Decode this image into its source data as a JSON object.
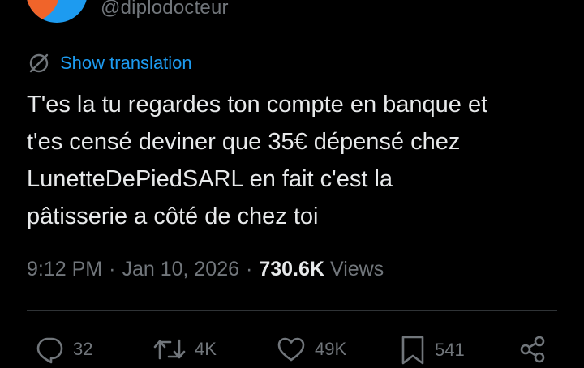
{
  "author": {
    "handle": "@diplodocteur",
    "avatar_colors": {
      "primary": "#1d9bf0",
      "accent": "#f0642a"
    }
  },
  "translation": {
    "icon": "globe-off-icon",
    "label": "Show translation"
  },
  "tweet": {
    "text": "T'es la tu regardes ton compte en banque et\nt'es censé deviner que 35€ dépensé chez\nLunetteDePiedSARL en fait c'est la\npâtisserie a côté de chez toi"
  },
  "meta": {
    "time": "9:12 PM",
    "separator": "·",
    "date": "Jan 10, 2026",
    "views_count": "730.6K",
    "views_label": "Views"
  },
  "actions": {
    "reply": {
      "icon": "reply-icon",
      "count": "32"
    },
    "retweet": {
      "icon": "retweet-icon",
      "count": "4K"
    },
    "like": {
      "icon": "heart-icon",
      "count": "49K"
    },
    "bookmark": {
      "icon": "bookmark-icon",
      "count": "541"
    },
    "share": {
      "icon": "share-icon"
    }
  },
  "colors": {
    "background": "#000000",
    "text": "#e7e9ea",
    "muted": "#71767b",
    "link": "#1d9bf0",
    "divider": "#2f3336"
  }
}
